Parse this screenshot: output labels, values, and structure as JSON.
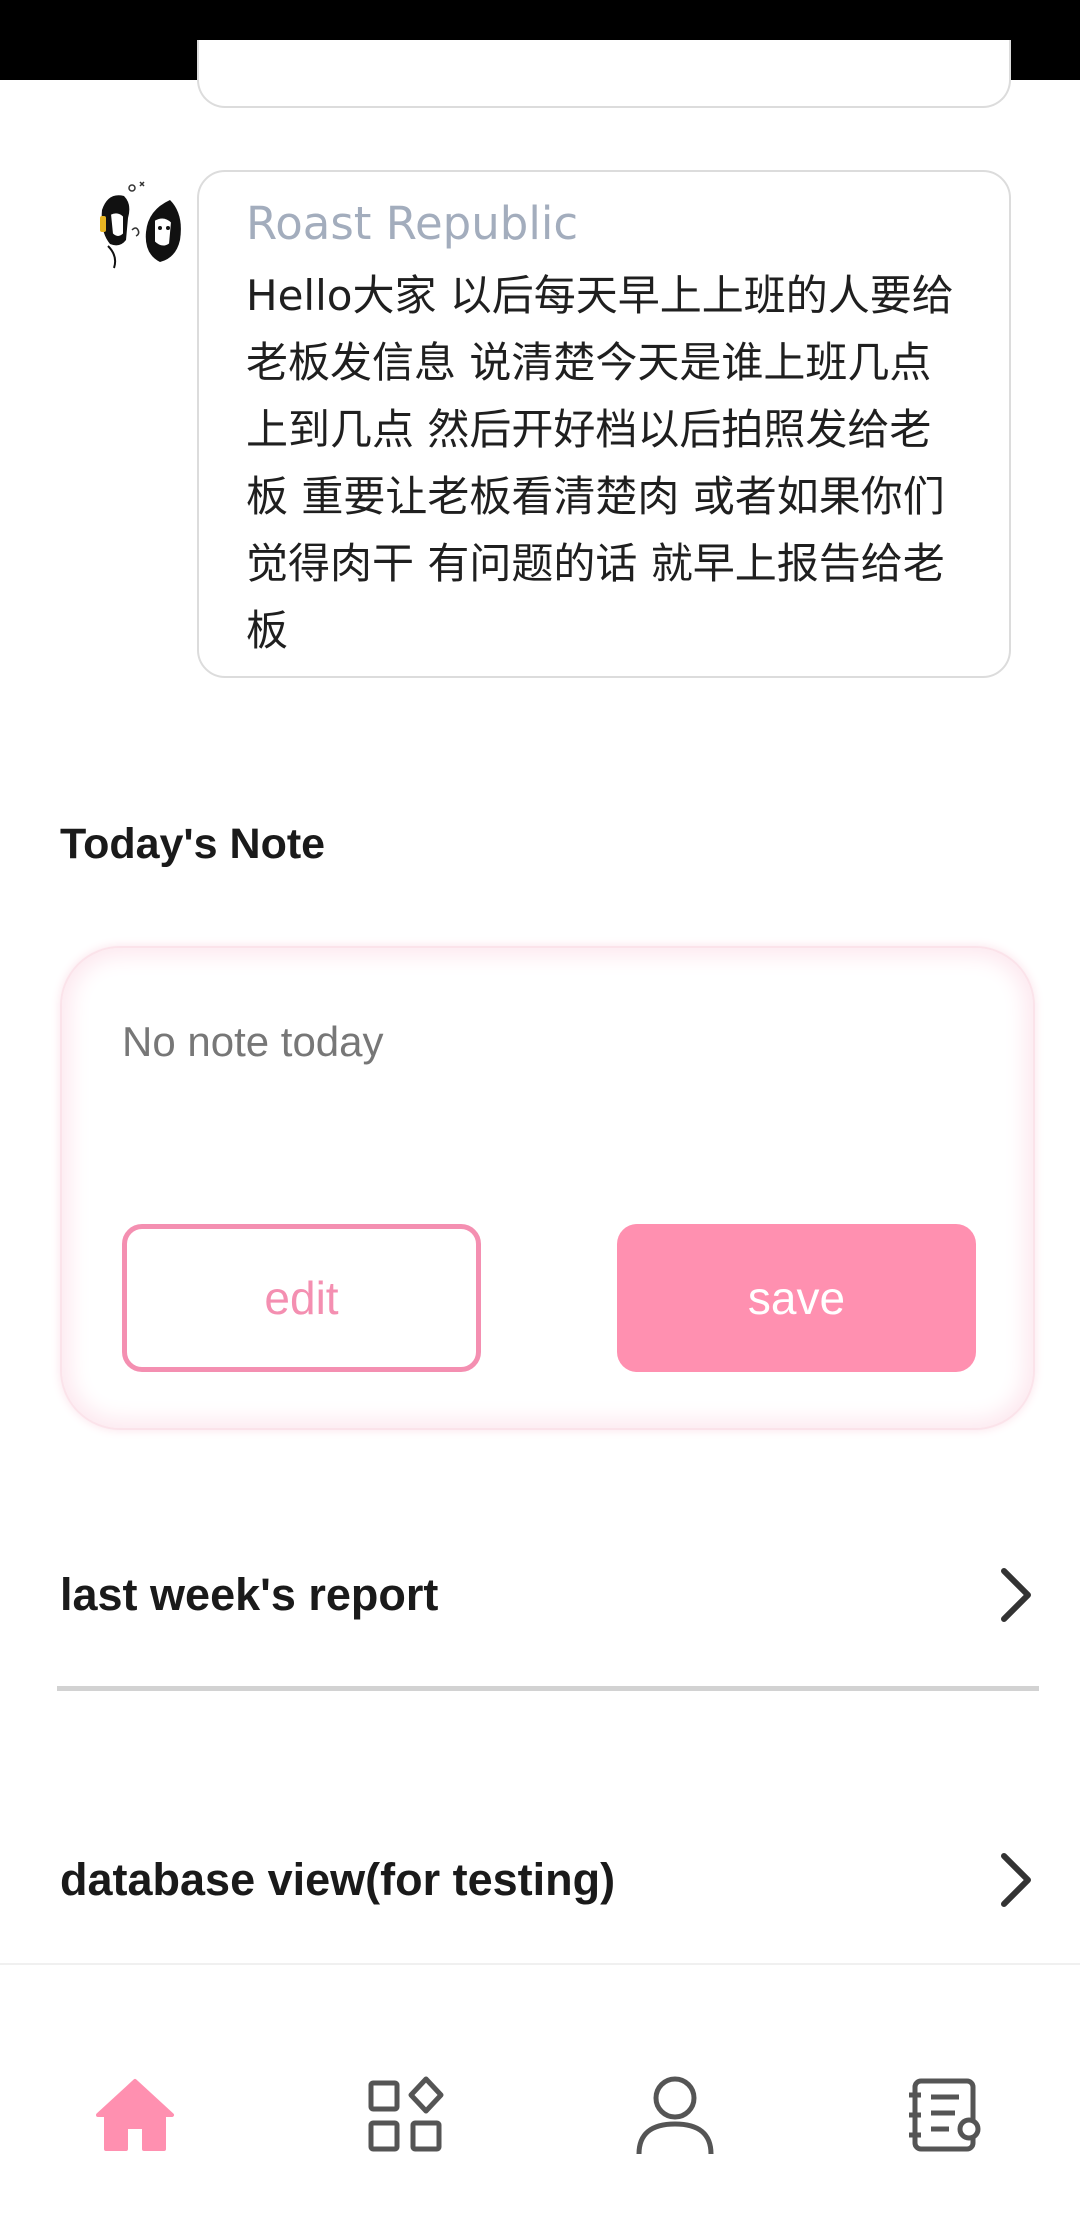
{
  "chat": {
    "message": {
      "sender": "Roast Republic",
      "text": "Hello大家 以后每天早上上班的人要给老板发信息 说清楚今天是谁上班几点上到几点 然后开好档以后拍照发给老板 重要让老板看清楚肉 或者如果你们觉得肉干 有问题的话 就早上报告给老板",
      "avatar_icon": "couple-illustration-avatar"
    }
  },
  "note": {
    "title": "Today's Note",
    "placeholder": "No note today",
    "edit_label": "edit",
    "save_label": "save"
  },
  "links": {
    "weekly_report": "last week's report",
    "database_view": "database view(for testing)"
  },
  "bottom_nav": {
    "items": [
      {
        "icon": "home-icon",
        "active": true
      },
      {
        "icon": "apps-icon",
        "active": false
      },
      {
        "icon": "user-icon",
        "active": false
      },
      {
        "icon": "notebook-icon",
        "active": false
      }
    ]
  },
  "colors": {
    "accent": "#ff90b0",
    "accent_outline": "#f48fb1",
    "inactive_icon": "#555555",
    "sender_name": "#a3adbd"
  }
}
